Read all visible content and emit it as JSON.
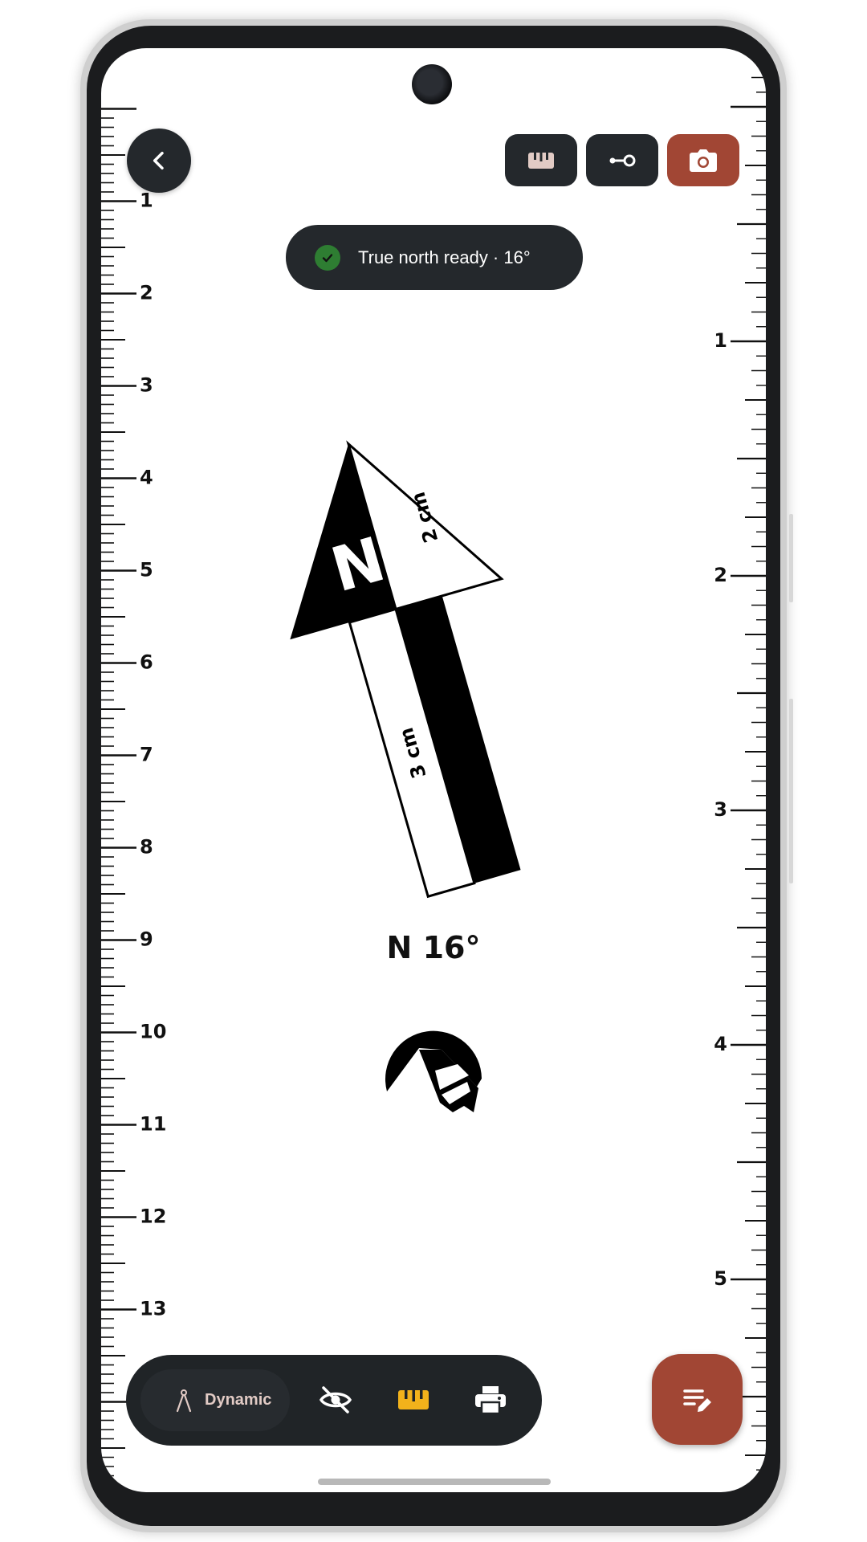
{
  "colors": {
    "dark_surface": "#24282c",
    "accent": "#a14634",
    "success": "#2e7d32",
    "ruler_active_icon": "#f2b21b",
    "mode_label": "#e2cbc5"
  },
  "header": {
    "back_icon": "chevron-left-icon",
    "actions": [
      {
        "icon": "ruler-icon",
        "active": false
      },
      {
        "icon": "key-icon",
        "active": false
      },
      {
        "icon": "camera-icon",
        "active": true
      }
    ]
  },
  "toast": {
    "icon": "check-circle-icon",
    "text": "True north ready · 16°"
  },
  "ruler_left": {
    "unit": "cm",
    "labels": [
      "1",
      "2",
      "3",
      "4",
      "5",
      "6",
      "7",
      "8",
      "9",
      "10",
      "11",
      "12",
      "13"
    ]
  },
  "ruler_right": {
    "unit": "in",
    "labels": [
      "1",
      "2",
      "3",
      "4",
      "5"
    ]
  },
  "arrow": {
    "letter": "N",
    "rotation_degrees": 16,
    "head_label": "2 cm",
    "shaft_label": "3 cm"
  },
  "heading_text": "N 16°",
  "logo_icon": "mountain-logo-icon",
  "bottom_bar": {
    "mode_icon": "compass-icon",
    "mode_label": "Dynamic",
    "tools": [
      {
        "icon": "eye-off-icon",
        "active": false
      },
      {
        "icon": "ruler-icon",
        "active": true
      },
      {
        "icon": "printer-icon",
        "active": false
      }
    ]
  },
  "fab": {
    "icon": "notes-edit-icon"
  }
}
